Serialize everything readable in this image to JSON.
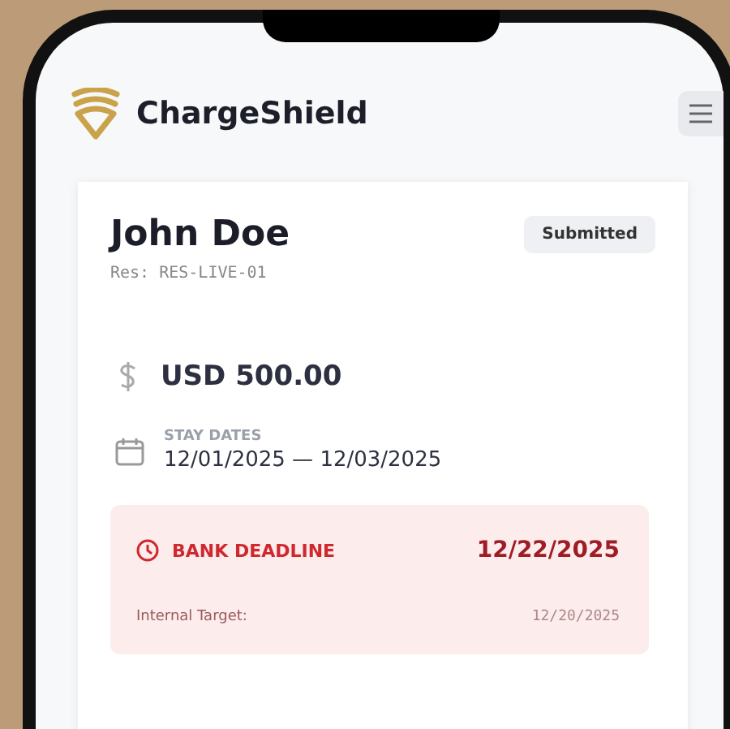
{
  "header": {
    "brand": "ChargeShield"
  },
  "case": {
    "name": "John Doe",
    "status": "Submitted",
    "reservation": "Res: RES-LIVE-01",
    "amount": "USD 500.00",
    "stay_dates": {
      "label": "STAY DATES",
      "value": "12/01/2025 — 12/03/2025"
    },
    "deadline": {
      "label": "BANK DEADLINE",
      "date": "12/22/2025",
      "internal_label": "Internal Target:",
      "internal_date": "12/20/2025"
    }
  }
}
